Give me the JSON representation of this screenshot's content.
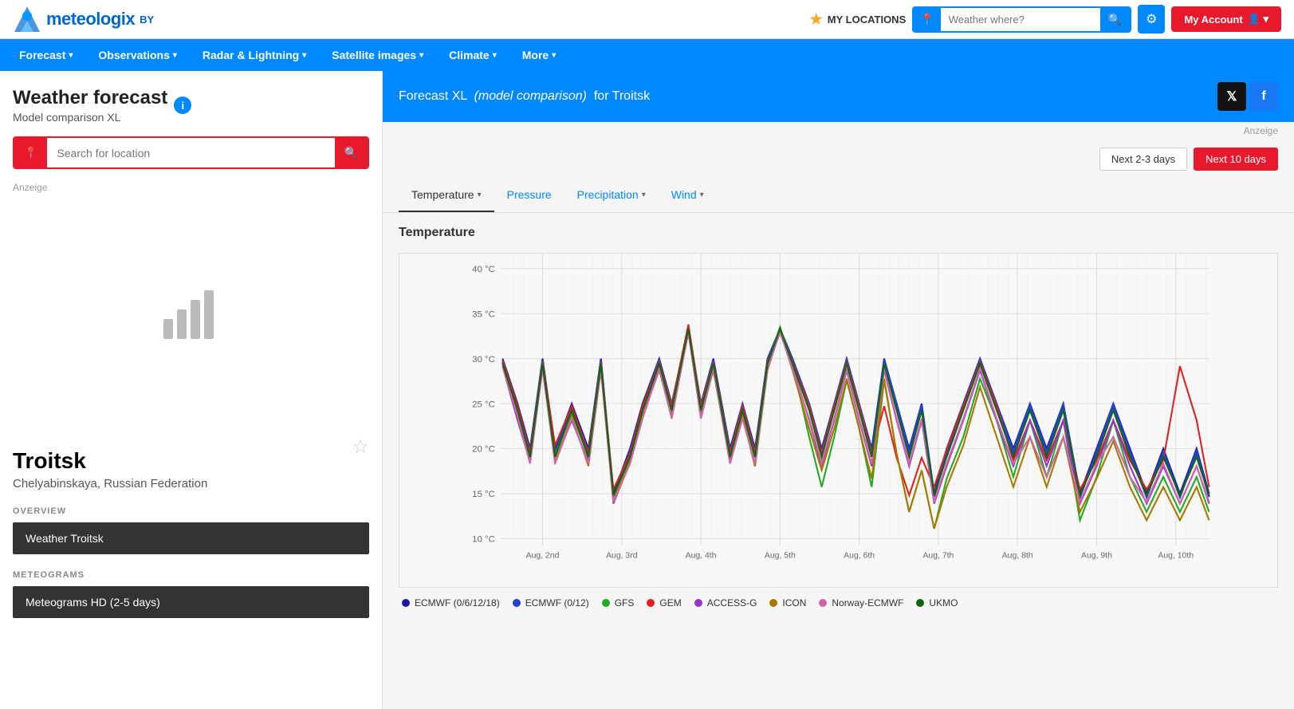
{
  "header": {
    "logo_text": "meteologix",
    "logo_by": "BY",
    "my_locations_label": "MY LOCATIONS",
    "search_placeholder": "Weather where?",
    "my_account_label": "My Account"
  },
  "nav": {
    "items": [
      {
        "label": "Forecast",
        "has_dropdown": true,
        "active": false
      },
      {
        "label": "Observations",
        "has_dropdown": true,
        "active": false
      },
      {
        "label": "Radar & Lightning",
        "has_dropdown": true,
        "active": false
      },
      {
        "label": "Satellite images",
        "has_dropdown": true,
        "active": false
      },
      {
        "label": "Climate",
        "has_dropdown": true,
        "active": false
      },
      {
        "label": "More",
        "has_dropdown": true,
        "active": false
      }
    ]
  },
  "sidebar": {
    "title": "Weather forecast",
    "subtitle": "Model comparison XL",
    "search_placeholder": "Search for location",
    "anzeige": "Anzeige",
    "location_name": "Troitsk",
    "location_sub": "Chelyabinskaya, Russian Federation",
    "overview_label": "OVERVIEW",
    "overview_items": [
      {
        "label": "Weather Troitsk"
      }
    ],
    "meteograms_label": "METEOGRAMS",
    "meteogram_items": [
      {
        "label": "Meteograms HD (2-5 days)"
      }
    ]
  },
  "forecast_bar": {
    "title_prefix": "Forecast XL",
    "title_middle": "(model comparison)",
    "title_suffix": "for Troitsk",
    "anzeige": "Anzeige"
  },
  "period_buttons": [
    {
      "label": "Next 2-3 days",
      "active": false
    },
    {
      "label": "Next 10 days",
      "active": true
    }
  ],
  "chart_tabs": [
    {
      "label": "Temperature",
      "has_dropdown": true,
      "active": true
    },
    {
      "label": "Pressure",
      "has_dropdown": false,
      "active": false
    },
    {
      "label": "Precipitation",
      "has_dropdown": true,
      "active": false
    },
    {
      "label": "Wind",
      "has_dropdown": true,
      "active": false
    }
  ],
  "chart": {
    "title": "Temperature",
    "x_labels": [
      "Aug, 2nd",
      "Aug, 3rd",
      "Aug, 4th",
      "Aug, 5th",
      "Aug, 6th",
      "Aug, 7th",
      "Aug, 8th",
      "Aug, 9th",
      "Aug, 10th"
    ],
    "y_labels": [
      "40 °C",
      "35 °C",
      "30 °C",
      "25 °C",
      "20 °C",
      "15 °C",
      "10 °C"
    ],
    "legend": [
      {
        "label": "ECMWF (0/6/12/18)",
        "color": "#1a1aaa"
      },
      {
        "label": "ECMWF (0/12)",
        "color": "#2244cc"
      },
      {
        "label": "GFS",
        "color": "#22aa22"
      },
      {
        "label": "GEM",
        "color": "#dd2222"
      },
      {
        "label": "ACCESS-G",
        "color": "#9933cc"
      },
      {
        "label": "ICON",
        "color": "#aa7700"
      },
      {
        "label": "Norway-ECMWF",
        "color": "#cc66aa"
      },
      {
        "label": "UKMO",
        "color": "#116611"
      }
    ]
  }
}
